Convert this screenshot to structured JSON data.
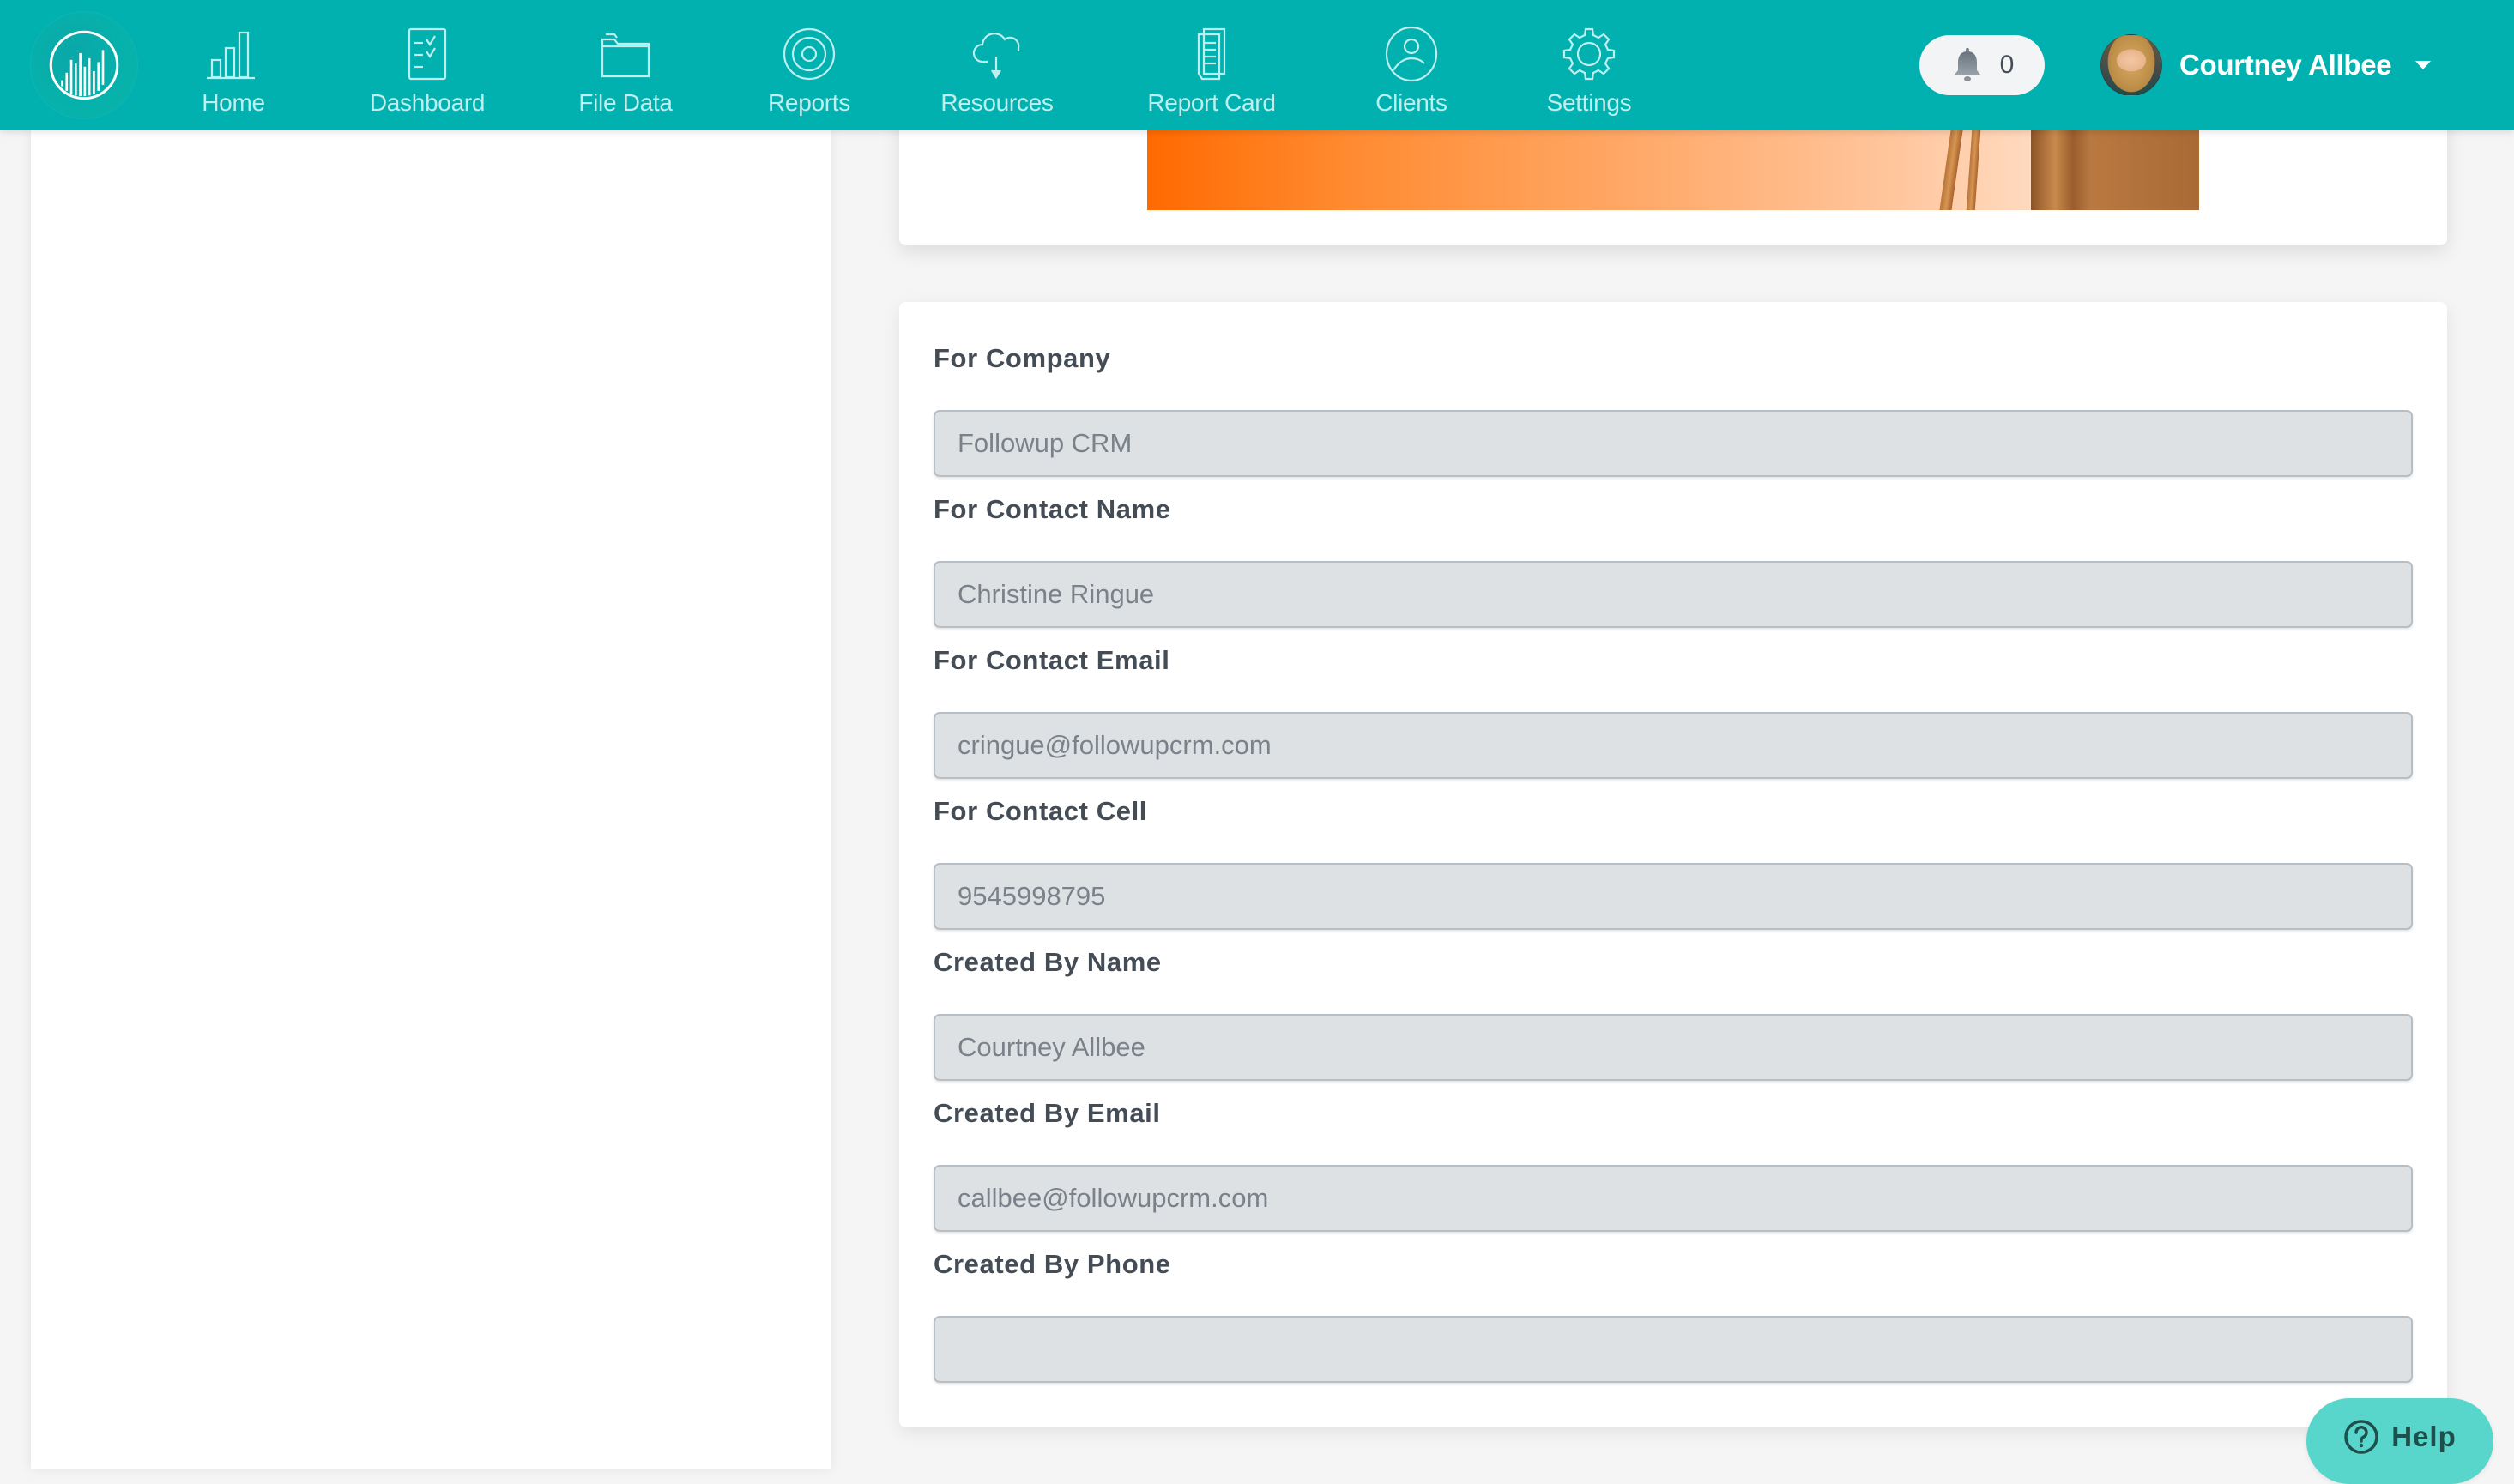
{
  "navbar": {
    "logo_icon": "sound-wave-circle-logo",
    "items": [
      {
        "label": "Home",
        "icon": "bar-chart-icon"
      },
      {
        "label": "Dashboard",
        "icon": "checklist-icon"
      },
      {
        "label": "File Data",
        "icon": "folder-icon"
      },
      {
        "label": "Reports",
        "icon": "target-icon"
      },
      {
        "label": "Resources",
        "icon": "cloud-download-icon"
      },
      {
        "label": "Report Card",
        "icon": "document-stack-icon"
      },
      {
        "label": "Clients",
        "icon": "user-circle-icon"
      },
      {
        "label": "Settings",
        "icon": "gear-icon"
      }
    ],
    "notifications": {
      "icon": "bell-icon",
      "count": "0"
    },
    "user": {
      "name": "Courtney Allbee",
      "menu_icon": "caret-down-icon"
    }
  },
  "colors": {
    "navbar": "#00b1b0",
    "nav_text": "#bfeeee",
    "input_bg": "#dee1e4",
    "label_text": "#444c55",
    "help_button": "#58d6cb",
    "banner_orange": "#ff6a00"
  },
  "form": {
    "fields": [
      {
        "label": "For Company",
        "value": "Followup CRM"
      },
      {
        "label": "For Contact Name",
        "value": "Christine Ringue"
      },
      {
        "label": "For Contact Email",
        "value": "cringue@followupcrm.com"
      },
      {
        "label": "For Contact Cell",
        "value": "9545998795"
      },
      {
        "label": "Created By Name",
        "value": "Courtney Allbee"
      },
      {
        "label": "Created By Email",
        "value": "callbee@followupcrm.com"
      },
      {
        "label": "Created By Phone",
        "value": ""
      }
    ]
  },
  "help": {
    "label": "Help",
    "icon": "question-circle-icon"
  }
}
